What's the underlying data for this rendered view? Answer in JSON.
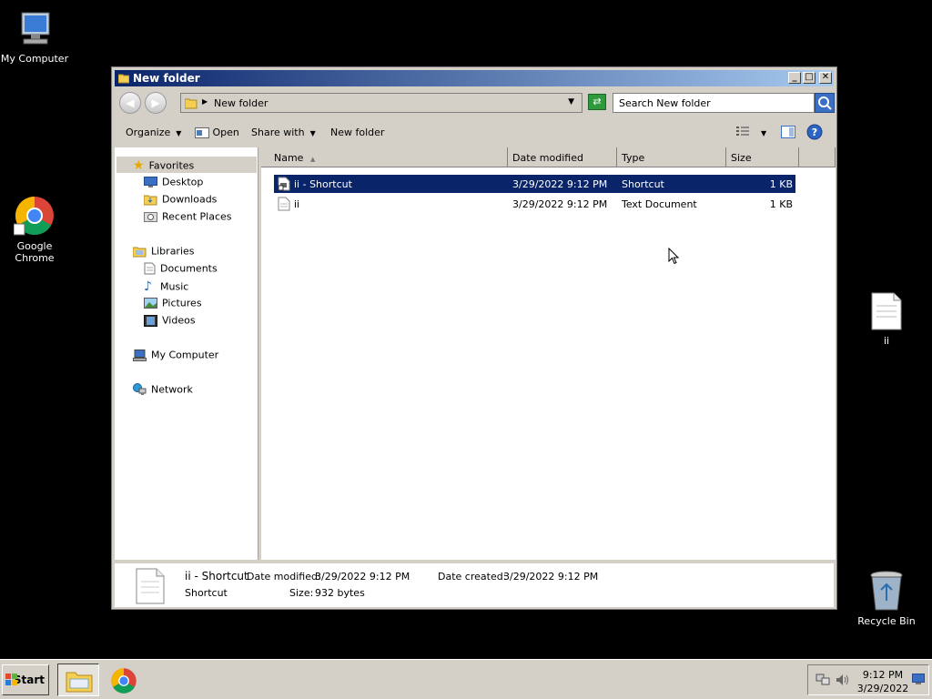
{
  "desktop": {
    "icons": [
      {
        "label": "My Computer"
      },
      {
        "label": "Google Chrome"
      },
      {
        "label": "ii"
      },
      {
        "label": "Recycle Bin"
      }
    ]
  },
  "window": {
    "title": "New folder",
    "address": "New folder",
    "search_placeholder": "Search New folder",
    "toolbar": {
      "organize": "Organize",
      "open": "Open",
      "share_with": "Share with",
      "new_folder": "New folder"
    },
    "nav": {
      "favorites": "Favorites",
      "desktop": "Desktop",
      "downloads": "Downloads",
      "recent_places": "Recent Places",
      "libraries": "Libraries",
      "documents": "Documents",
      "music": "Music",
      "pictures": "Pictures",
      "videos": "Videos",
      "my_computer": "My Computer",
      "network": "Network"
    },
    "columns": {
      "name": "Name",
      "date": "Date modified",
      "type": "Type",
      "size": "Size"
    },
    "files": [
      {
        "name": "ii - Shortcut",
        "date": "3/29/2022 9:12 PM",
        "type": "Shortcut",
        "size": "1 KB",
        "selected": true
      },
      {
        "name": "ii",
        "date": "3/29/2022 9:12 PM",
        "type": "Text Document",
        "size": "1 KB",
        "selected": false
      }
    ],
    "details": {
      "name": "ii - Shortcut",
      "type": "Shortcut",
      "modified_label": "Date modified:",
      "modified": "3/29/2022 9:12 PM",
      "created_label": "Date created:",
      "created": "3/29/2022 9:12 PM",
      "size_label": "Size:",
      "size": "932 bytes"
    }
  },
  "taskbar": {
    "start": "Start",
    "time": "9:12 PM",
    "date": "3/29/2022"
  },
  "colors": {
    "selection": "#0a246a",
    "titlebar": "#0a246a",
    "chrome_face": "#d4d0c8"
  }
}
